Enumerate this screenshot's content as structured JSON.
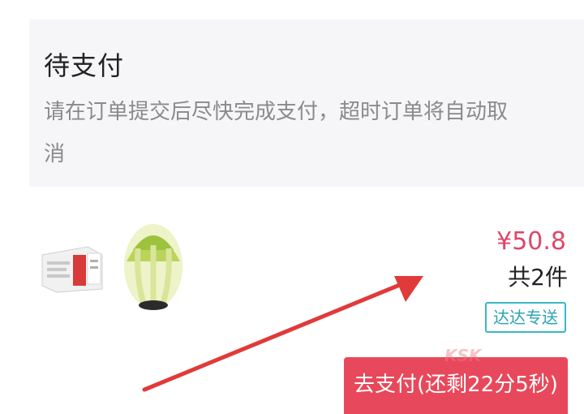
{
  "notice": {
    "title": "待支付",
    "body": "请在订单提交后尽快完成支付，超时订单将自动取消"
  },
  "order": {
    "products": [
      {
        "icon": "product-box-icon"
      },
      {
        "icon": "cabbage-icon"
      }
    ],
    "price": "¥50.8",
    "count": "共2件",
    "delivery_tag": "达达专送"
  },
  "actions": {
    "pay_label": "去支付(还剩22分5秒)"
  },
  "watermark": "KSK",
  "colors": {
    "price": "#e0456a",
    "pay_button": "#e8485b",
    "tag_border": "#3cb7c6",
    "arrow": "#e03a3a",
    "notice_bg": "#f6f6f8"
  }
}
